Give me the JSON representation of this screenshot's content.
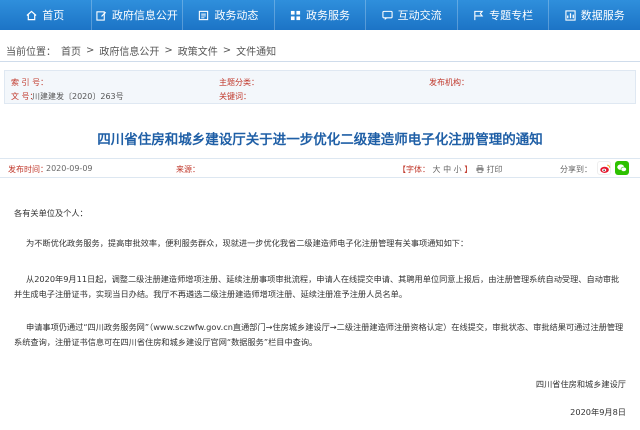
{
  "nav": [
    {
      "label": "首页",
      "icon": "home-icon"
    },
    {
      "label": "政府信息公开",
      "icon": "edit-icon"
    },
    {
      "label": "政务动态",
      "icon": "list-icon"
    },
    {
      "label": "政务服务",
      "icon": "grid-icon"
    },
    {
      "label": "互动交流",
      "icon": "chat-icon"
    },
    {
      "label": "专题专栏",
      "icon": "flag-icon"
    },
    {
      "label": "数据服务",
      "icon": "chart-icon"
    }
  ],
  "breadcrumb": {
    "prefix": "当前位置：",
    "items": [
      "首页",
      "政府信息公开",
      "政策文件",
      "文件通知"
    ],
    "sep": ">"
  },
  "meta": {
    "index_label": "索  引  号：",
    "topic_label": "主题分类：",
    "issuer_label": "发布机构：",
    "docno_label": "文  号：",
    "docno_value": "川建建发〔2020〕263号",
    "keywords_label": "关键词："
  },
  "title": "四川省住房和城乡建设厅关于进一步优化二级建造师电子化注册管理的通知",
  "info": {
    "date_label": "发布时间：",
    "date_value": "2020-09-09",
    "source_label": "来源：",
    "fontsize_label": "【字体：",
    "fontsize_big": "大",
    "fontsize_mid": "中",
    "fontsize_small": "小",
    "fontsize_end": "】",
    "print_label": "打印",
    "share_label": "分享到："
  },
  "body": {
    "greeting": "各有关单位及个人：",
    "p1": "为不断优化政务服务，提高审批效率，便利服务群众，现就进一步优化我省二级建造师电子化注册管理有关事项通知如下：",
    "p2": "从2020年9月11日起，调整二级注册建造师增项注册、延续注册事项审批流程，申请人在线提交申请、其聘用单位同意上报后，由注册管理系统自动受理、自动审批并生成电子注册证书，实现当日办结。我厅不再遴选二级注册建造师增项注册、延续注册准予注册人员名单。",
    "p3": "申请事项仍通过“四川政务服务网”（www.sczwfw.gov.cn直通部门→住房城乡建设厅→二级注册建造师注册资格认定）在线提交，审批状态、审批结果可通过注册管理系统查询，注册证书信息可在四川省住房和城乡建设厅官网“数据服务”栏目中查询。",
    "signature": "四川省住房和城乡建设厅",
    "sign_date": "2020年9月8日"
  },
  "colors": {
    "nav_bg": "#1f78c9",
    "title": "#1f5fa6",
    "label_red": "#c0382b",
    "weibo": "#e6162d",
    "wechat": "#2dc100"
  }
}
